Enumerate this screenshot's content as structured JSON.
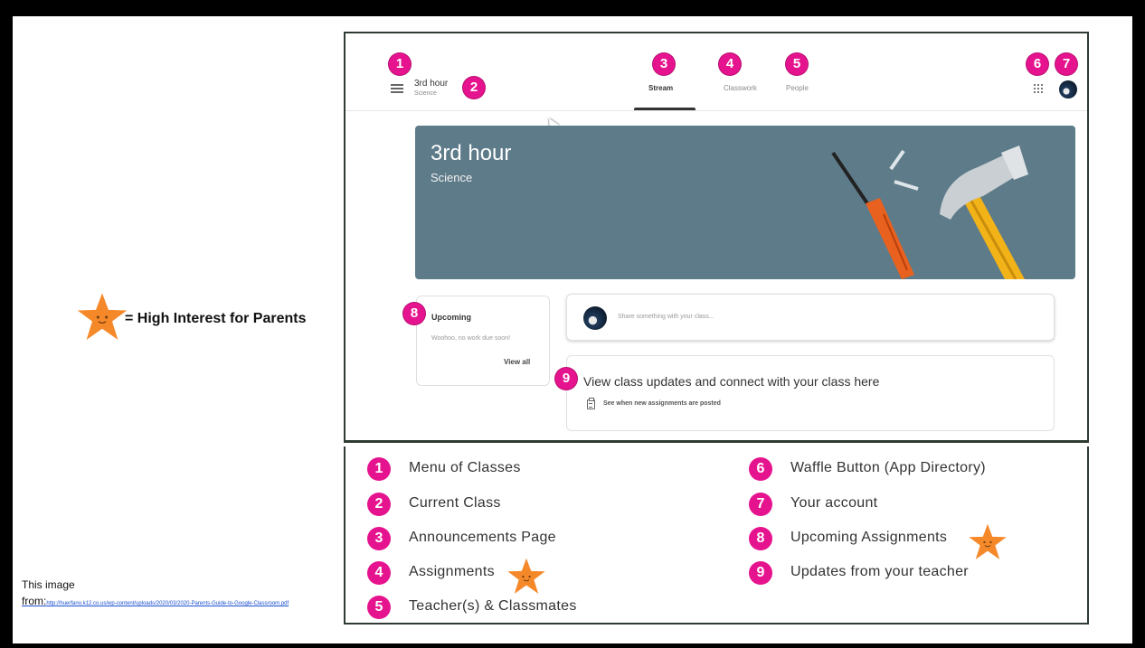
{
  "key": {
    "text": "= High Interest for Parents"
  },
  "credit": {
    "prefix": "This image",
    "from_label": "from:",
    "url": "http://huerfano.k12.co.us/wp-content/uploads/2020/03/2020-Parents-Guide-to-Google-Classroom.pdf"
  },
  "classroom": {
    "class_name": "3rd hour",
    "class_section": "Science",
    "tabs": [
      {
        "label": "Stream",
        "active": true
      },
      {
        "label": "Classwork",
        "active": false
      },
      {
        "label": "People",
        "active": false
      }
    ],
    "banner": {
      "title": "3rd hour",
      "subtitle": "Science",
      "color": "#5e7b89"
    },
    "upcoming": {
      "title": "Upcoming",
      "empty_text": "Woohoo, no work due soon!",
      "view_all": "View all"
    },
    "share": {
      "placeholder": "Share something with your class..."
    },
    "updates": {
      "title": "View class updates and connect with your class here",
      "subtitle": "See when new assignments are posted"
    }
  },
  "badges": [
    "1",
    "2",
    "3",
    "4",
    "5",
    "6",
    "7",
    "8",
    "9"
  ],
  "legend": {
    "left": [
      {
        "num": "1",
        "text": "Menu of Classes"
      },
      {
        "num": "2",
        "text": "Current Class"
      },
      {
        "num": "3",
        "text": "Announcements Page"
      },
      {
        "num": "4",
        "text": "Assignments",
        "starred": true
      },
      {
        "num": "5",
        "text": "Teacher(s) & Classmates"
      }
    ],
    "right": [
      {
        "num": "6",
        "text": "Waffle Button (App Directory)"
      },
      {
        "num": "7",
        "text": "Your account"
      },
      {
        "num": "8",
        "text": "Upcoming Assignments",
        "starred": true
      },
      {
        "num": "9",
        "text": "Updates from your teacher"
      }
    ]
  },
  "colors": {
    "badge": "#e6138f",
    "star": "#f5892a",
    "banner": "#5e7b89"
  }
}
